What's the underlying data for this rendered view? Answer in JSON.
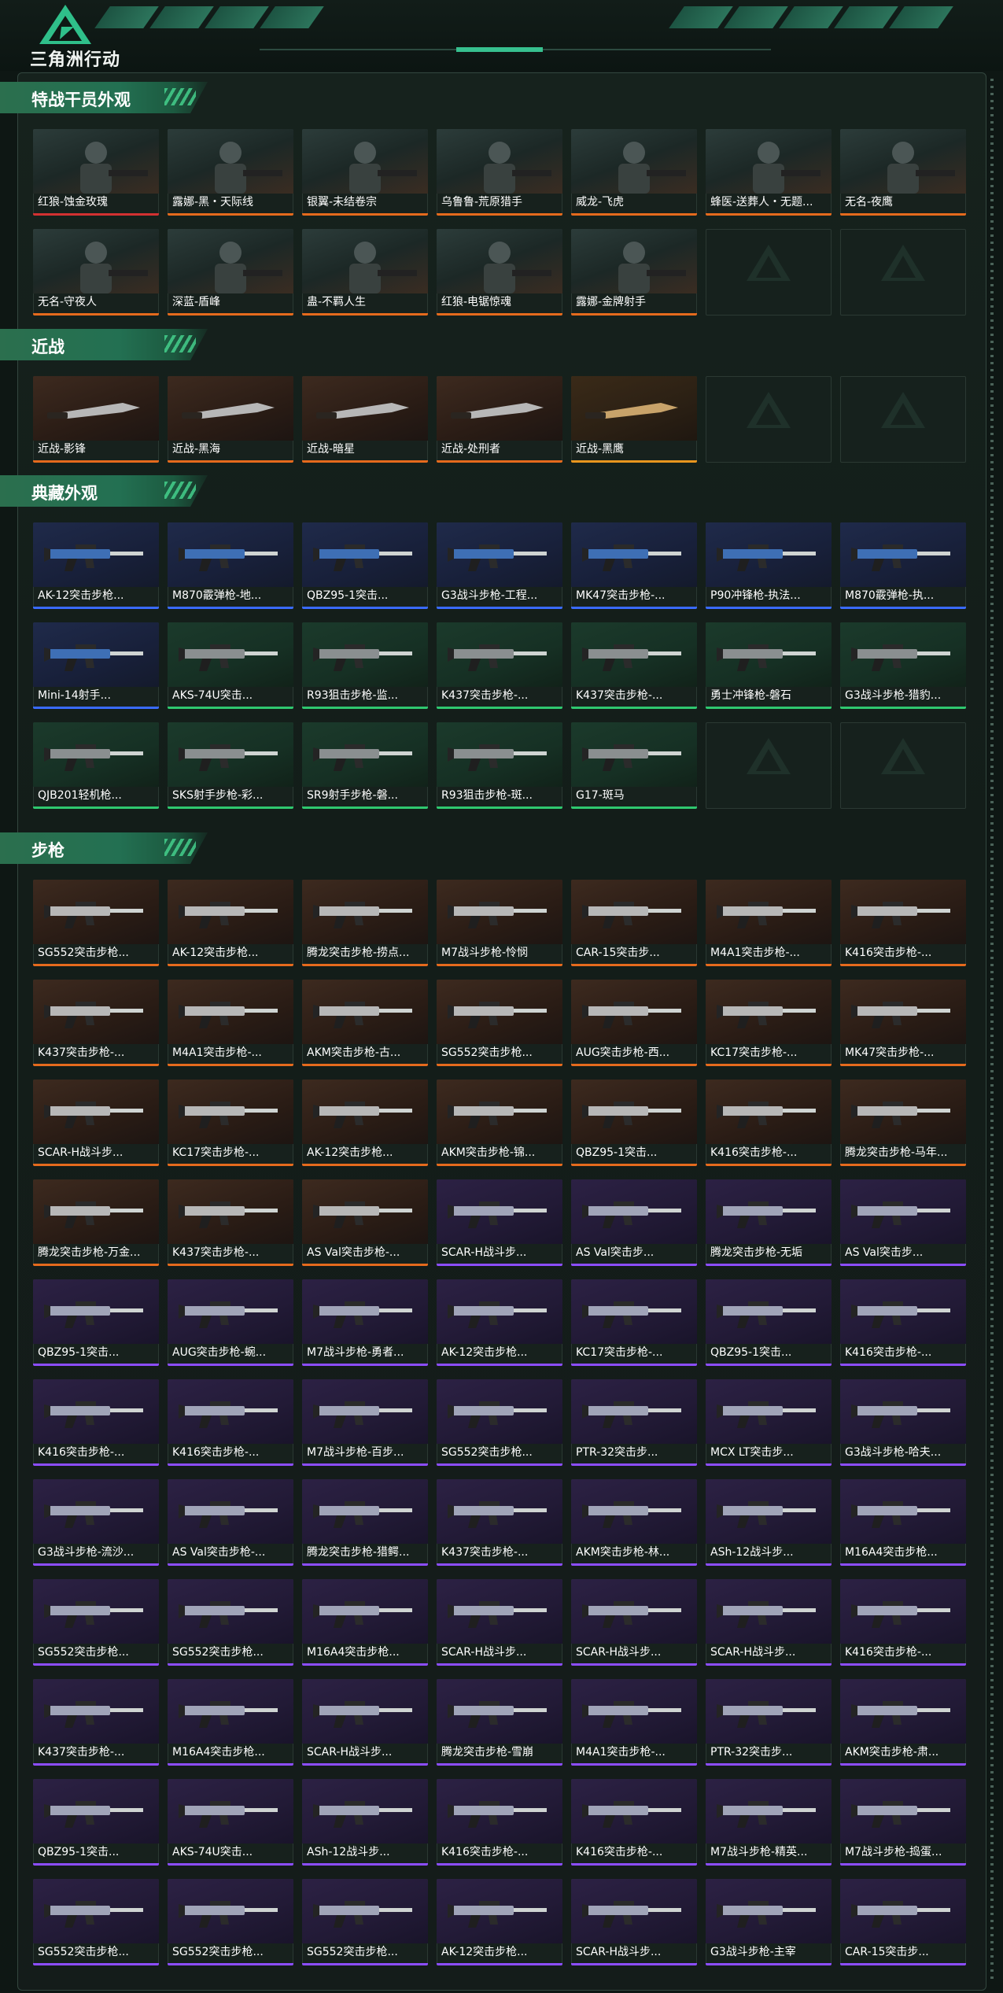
{
  "app": {
    "title": "三角洲行动"
  },
  "colors": {
    "accent": "#37c08f",
    "orange": "#e56a1d",
    "blue": "#3a6bff",
    "green": "#2fc76f",
    "purple": "#8c4dff",
    "gold": "#e8951e",
    "red": "#d33131"
  },
  "sections": [
    {
      "title": "特战干员外观",
      "kind": "agent",
      "items": [
        {
          "label": "红狼-蚀金玫瑰",
          "rarity": "red"
        },
        {
          "label": "露娜-黑・天际线",
          "rarity": "orange"
        },
        {
          "label": "银翼-未结卷宗",
          "rarity": "orange"
        },
        {
          "label": "乌鲁鲁-荒原猎手",
          "rarity": "orange"
        },
        {
          "label": "威龙-飞虎",
          "rarity": "orange"
        },
        {
          "label": "蜂医-送葬人・无题...",
          "rarity": "orange"
        },
        {
          "label": "无名-夜鹰",
          "rarity": "orange"
        },
        {
          "label": "无名-守夜人",
          "rarity": "orange"
        },
        {
          "label": "深蓝-盾峰",
          "rarity": "orange"
        },
        {
          "label": "蛊-不羁人生",
          "rarity": "orange"
        },
        {
          "label": "红狼-电锯惊魂",
          "rarity": "orange"
        },
        {
          "label": "露娜-金牌射手",
          "rarity": "orange"
        },
        {
          "label": "",
          "rarity": "empty"
        },
        {
          "label": "",
          "rarity": "empty"
        }
      ]
    },
    {
      "title": "近战",
      "kind": "melee",
      "items": [
        {
          "label": "近战-影锋",
          "rarity": "orange"
        },
        {
          "label": "近战-黑海",
          "rarity": "orange"
        },
        {
          "label": "近战-暗星",
          "rarity": "orange"
        },
        {
          "label": "近战-处刑者",
          "rarity": "orange"
        },
        {
          "label": "近战-黑鹰",
          "rarity": "gold"
        },
        {
          "label": "",
          "rarity": "empty"
        },
        {
          "label": "",
          "rarity": "empty"
        }
      ]
    },
    {
      "title": "典藏外观",
      "kind": "gun",
      "items": [
        {
          "label": "AK-12突击步枪...",
          "rarity": "blue"
        },
        {
          "label": "M870霰弹枪-地...",
          "rarity": "blue"
        },
        {
          "label": "QBZ95-1突击...",
          "rarity": "blue"
        },
        {
          "label": "G3战斗步枪-工程...",
          "rarity": "blue"
        },
        {
          "label": "MK47突击步枪-...",
          "rarity": "blue"
        },
        {
          "label": "P90冲锋枪-执法...",
          "rarity": "blue"
        },
        {
          "label": "M870霰弹枪-执...",
          "rarity": "blue"
        },
        {
          "label": "Mini-14射手...",
          "rarity": "blue"
        },
        {
          "label": "AKS-74U突击...",
          "rarity": "green"
        },
        {
          "label": "R93狙击步枪-监...",
          "rarity": "green"
        },
        {
          "label": "K437突击步枪-...",
          "rarity": "green"
        },
        {
          "label": "K437突击步枪-...",
          "rarity": "green"
        },
        {
          "label": "勇士冲锋枪-磐石",
          "rarity": "green"
        },
        {
          "label": "G3战斗步枪-猎豹...",
          "rarity": "green"
        },
        {
          "label": "QJB201轻机枪...",
          "rarity": "green"
        },
        {
          "label": "SKS射手步枪-彩...",
          "rarity": "green"
        },
        {
          "label": "SR9射手步枪-磐...",
          "rarity": "green"
        },
        {
          "label": "R93狙击步枪-斑...",
          "rarity": "green"
        },
        {
          "label": "G17-斑马",
          "rarity": "green"
        },
        {
          "label": "",
          "rarity": "empty"
        },
        {
          "label": "",
          "rarity": "empty"
        }
      ]
    },
    {
      "title": "步枪",
      "kind": "gun",
      "items": [
        {
          "label": "SG552突击步枪...",
          "rarity": "orange"
        },
        {
          "label": "AK-12突击步枪...",
          "rarity": "orange"
        },
        {
          "label": "腾龙突击步枪-捞点...",
          "rarity": "orange"
        },
        {
          "label": "M7战斗步枪-怜悯",
          "rarity": "orange"
        },
        {
          "label": "CAR-15突击步...",
          "rarity": "orange"
        },
        {
          "label": "M4A1突击步枪-...",
          "rarity": "orange"
        },
        {
          "label": "K416突击步枪-...",
          "rarity": "orange"
        },
        {
          "label": "K437突击步枪-...",
          "rarity": "orange"
        },
        {
          "label": "M4A1突击步枪-...",
          "rarity": "orange"
        },
        {
          "label": "AKM突击步枪-古...",
          "rarity": "orange"
        },
        {
          "label": "SG552突击步枪...",
          "rarity": "orange"
        },
        {
          "label": "AUG突击步枪-西...",
          "rarity": "orange"
        },
        {
          "label": "KC17突击步枪-...",
          "rarity": "orange"
        },
        {
          "label": "MK47突击步枪-...",
          "rarity": "orange"
        },
        {
          "label": "SCAR-H战斗步...",
          "rarity": "orange"
        },
        {
          "label": "KC17突击步枪-...",
          "rarity": "orange"
        },
        {
          "label": "AK-12突击步枪...",
          "rarity": "orange"
        },
        {
          "label": "AKM突击步枪-锦...",
          "rarity": "orange"
        },
        {
          "label": "QBZ95-1突击...",
          "rarity": "orange"
        },
        {
          "label": "K416突击步枪-...",
          "rarity": "orange"
        },
        {
          "label": "腾龙突击步枪-马年...",
          "rarity": "orange"
        },
        {
          "label": "腾龙突击步枪-万金...",
          "rarity": "orange"
        },
        {
          "label": "K437突击步枪-...",
          "rarity": "orange"
        },
        {
          "label": "AS Val突击步枪-...",
          "rarity": "orange"
        },
        {
          "label": "SCAR-H战斗步...",
          "rarity": "purple"
        },
        {
          "label": "AS Val突击步...",
          "rarity": "purple"
        },
        {
          "label": "腾龙突击步枪-无垢",
          "rarity": "purple"
        },
        {
          "label": "AS Val突击步...",
          "rarity": "purple"
        },
        {
          "label": "QBZ95-1突击...",
          "rarity": "purple"
        },
        {
          "label": "AUG突击步枪-蜿...",
          "rarity": "purple"
        },
        {
          "label": "M7战斗步枪-勇者...",
          "rarity": "purple"
        },
        {
          "label": "AK-12突击步枪...",
          "rarity": "purple"
        },
        {
          "label": "KC17突击步枪-...",
          "rarity": "purple"
        },
        {
          "label": "QBZ95-1突击...",
          "rarity": "purple"
        },
        {
          "label": "K416突击步枪-...",
          "rarity": "purple"
        },
        {
          "label": "K416突击步枪-...",
          "rarity": "purple"
        },
        {
          "label": "K416突击步枪-...",
          "rarity": "purple"
        },
        {
          "label": "M7战斗步枪-百步...",
          "rarity": "purple"
        },
        {
          "label": "SG552突击步枪...",
          "rarity": "purple"
        },
        {
          "label": "PTR-32突击步...",
          "rarity": "purple"
        },
        {
          "label": "MCX LT突击步...",
          "rarity": "purple"
        },
        {
          "label": "G3战斗步枪-哈夫...",
          "rarity": "purple"
        },
        {
          "label": "G3战斗步枪-流沙...",
          "rarity": "purple"
        },
        {
          "label": "AS Val突击步枪-...",
          "rarity": "purple"
        },
        {
          "label": "腾龙突击步枪-猎鳄...",
          "rarity": "purple"
        },
        {
          "label": "K437突击步枪-...",
          "rarity": "purple"
        },
        {
          "label": "AKM突击步枪-林...",
          "rarity": "purple"
        },
        {
          "label": "ASh-12战斗步...",
          "rarity": "purple"
        },
        {
          "label": "M16A4突击步枪...",
          "rarity": "purple"
        },
        {
          "label": "SG552突击步枪...",
          "rarity": "purple"
        },
        {
          "label": "SG552突击步枪...",
          "rarity": "purple"
        },
        {
          "label": "M16A4突击步枪...",
          "rarity": "purple"
        },
        {
          "label": "SCAR-H战斗步...",
          "rarity": "purple"
        },
        {
          "label": "SCAR-H战斗步...",
          "rarity": "purple"
        },
        {
          "label": "SCAR-H战斗步...",
          "rarity": "purple"
        },
        {
          "label": "K416突击步枪-...",
          "rarity": "purple"
        },
        {
          "label": "K437突击步枪-...",
          "rarity": "purple"
        },
        {
          "label": "M16A4突击步枪...",
          "rarity": "purple"
        },
        {
          "label": "SCAR-H战斗步...",
          "rarity": "purple"
        },
        {
          "label": "腾龙突击步枪-雪崩",
          "rarity": "purple"
        },
        {
          "label": "M4A1突击步枪-...",
          "rarity": "purple"
        },
        {
          "label": "PTR-32突击步...",
          "rarity": "purple"
        },
        {
          "label": "AKM突击步枪-肃...",
          "rarity": "purple"
        },
        {
          "label": "QBZ95-1突击...",
          "rarity": "purple"
        },
        {
          "label": "AKS-74U突击...",
          "rarity": "purple"
        },
        {
          "label": "ASh-12战斗步...",
          "rarity": "purple"
        },
        {
          "label": "K416突击步枪-...",
          "rarity": "purple"
        },
        {
          "label": "K416突击步枪-...",
          "rarity": "purple"
        },
        {
          "label": "M7战斗步枪-精英...",
          "rarity": "purple"
        },
        {
          "label": "M7战斗步枪-捣蛋...",
          "rarity": "purple"
        },
        {
          "label": "SG552突击步枪...",
          "rarity": "purple"
        },
        {
          "label": "SG552突击步枪...",
          "rarity": "purple"
        },
        {
          "label": "SG552突击步枪...",
          "rarity": "purple"
        },
        {
          "label": "AK-12突击步枪...",
          "rarity": "purple"
        },
        {
          "label": "SCAR-H战斗步...",
          "rarity": "purple"
        },
        {
          "label": "G3战斗步枪-主宰",
          "rarity": "purple"
        },
        {
          "label": "CAR-15突击步...",
          "rarity": "purple"
        }
      ]
    }
  ]
}
